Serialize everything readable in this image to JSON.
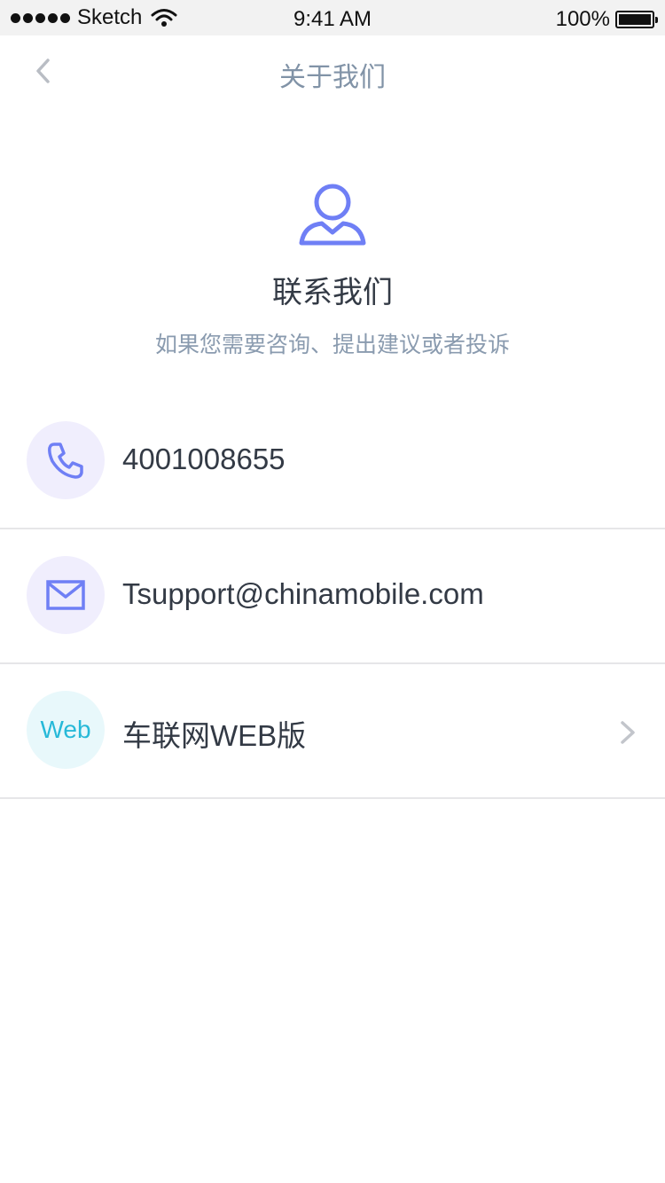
{
  "status_bar": {
    "carrier": "Sketch",
    "time": "9:41 AM",
    "battery": "100%"
  },
  "nav": {
    "title": "关于我们"
  },
  "hero": {
    "title": "联系我们",
    "subtitle": "如果您需要咨询、提出建议或者投诉"
  },
  "contacts": [
    {
      "icon": "phone-icon",
      "label": "4001008655"
    },
    {
      "icon": "mail-icon",
      "label": "Tsupport@chinamobile.com"
    },
    {
      "icon": "web-icon",
      "icon_text": "Web",
      "label": "车联网WEB版"
    }
  ],
  "colors": {
    "accent_purple": "#6f7ff5",
    "accent_cyan": "#27b9d8",
    "text_primary": "#333a45",
    "text_secondary": "#8a9baf"
  }
}
